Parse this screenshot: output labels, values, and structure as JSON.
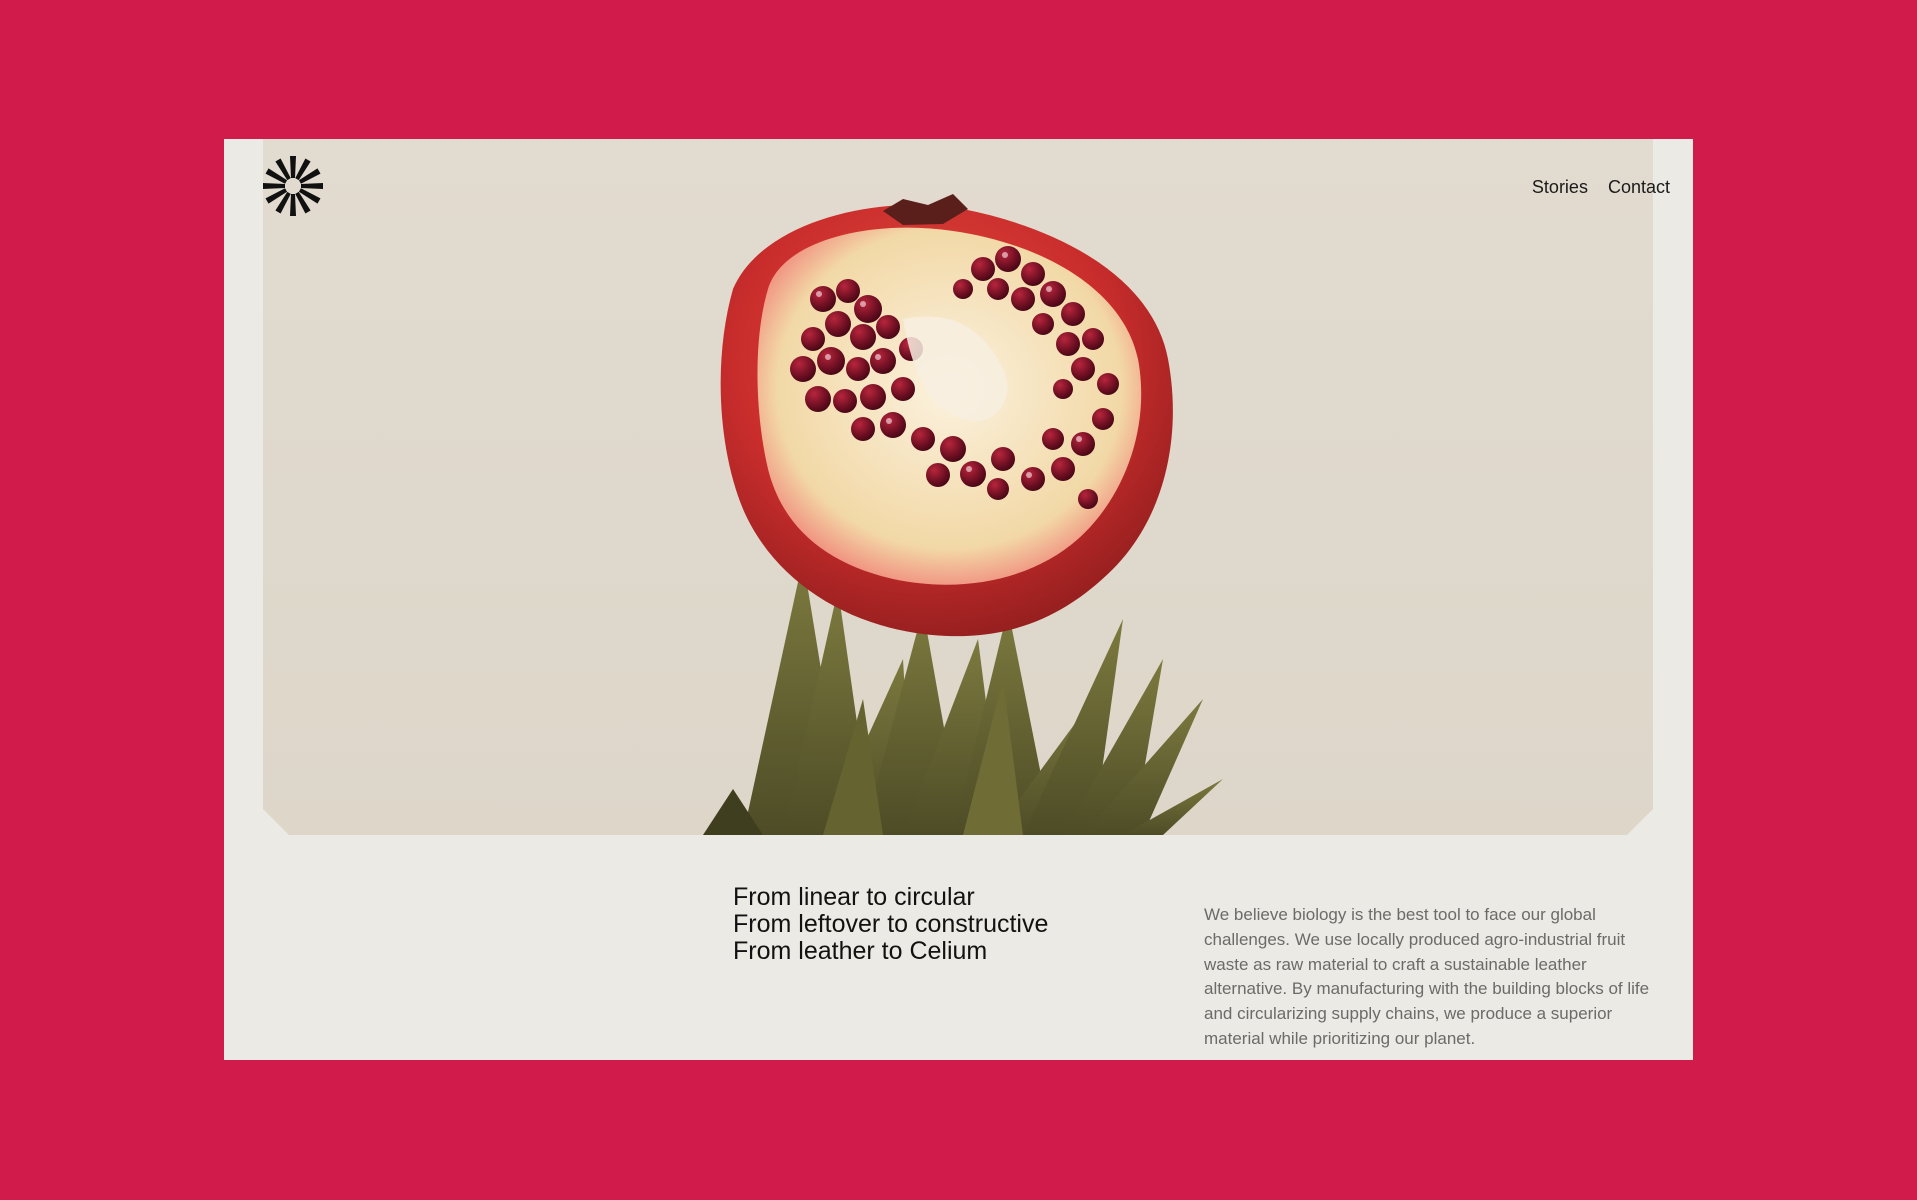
{
  "nav": {
    "items": [
      {
        "label": "Stories"
      },
      {
        "label": "Contact"
      }
    ]
  },
  "hero": {
    "image": "pomegranate-on-pineapple-crown"
  },
  "tagline": {
    "lines": [
      "From linear to circular",
      "From leftover to constructive",
      "From leather to Celium"
    ]
  },
  "description": {
    "text": "We believe biology is the best tool to face our global challenges. We use locally produced agro-industrial fruit waste as raw material to craft a sustainable leather alternative. By manufacturing with the building blocks of life and circularizing supply chains, we produce a superior material while prioritizing our planet."
  },
  "colors": {
    "background": "#d11b4b",
    "panel": "#ebeae4",
    "hero_bg": "#e0d9cd",
    "text_dark": "#121212",
    "text_muted": "#6b6b69"
  }
}
